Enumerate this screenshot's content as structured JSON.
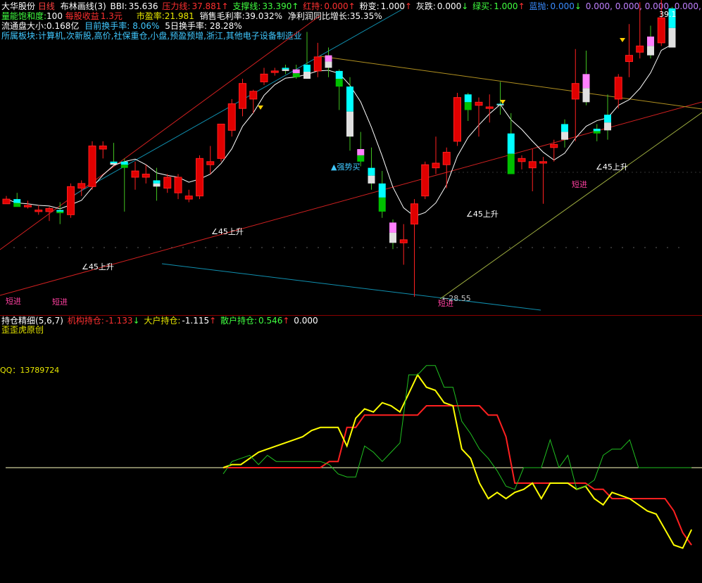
{
  "header": {
    "stock_name": "大华股份",
    "period": "日线",
    "indicator_name": "布林画线(3)",
    "bbi_label": "BBI:",
    "bbi_value": "35.636",
    "resistance_label": "压力线:",
    "resistance_value": "37.881",
    "support_label": "支撑线:",
    "support_value": "33.390",
    "red_hold_label": "红持:",
    "red_hold_value": "0.000",
    "pink_label": "粉变:",
    "pink_value": "1.000",
    "gray_label": "灰跌:",
    "gray_value": "0.000",
    "green_buy_label": "绿买:",
    "green_buy_value": "1.000",
    "blue_sell_label": "蓝抛:",
    "blue_sell_value": "0.000",
    "extra_values": "0.000, 0.000, 0.000, 0.000,",
    "arrow_up": "↑",
    "arrow_down": "↓"
  },
  "info": {
    "saturation_label": "量能饱和度:",
    "saturation_value": "100",
    "eps_label": "每股收益",
    "eps_value": "1.3元",
    "pe_label": "市盈率:",
    "pe_value": "21.981",
    "gross_margin_label": "销售毛利率:",
    "gross_margin_value": "39.032%",
    "profit_growth_label": "净利润同比增长:",
    "profit_growth_value": "35.35%",
    "float_label": "流通盘大小:",
    "float_value": "0.168亿",
    "turnover_label": "目前换手率:",
    "turnover_value": "8.06%",
    "turnover5_label": "5日换手率:",
    "turnover5_value": "28.28%",
    "sector_label": "所属板块:",
    "sector_value": "计算机,次新股,高价,社保重仓,小盘,预盈预增,浙江,其他电子设备制造业"
  },
  "annotations": {
    "price_high": "39.1",
    "price_low": "28.55",
    "short_entry": "短进",
    "rise45": "45上升",
    "strong_buy": "▲强势买"
  },
  "lower": {
    "title": "持仓精细",
    "params": "(5,6,7)",
    "inst_label": "机构持仓:",
    "inst_value": "-1.133",
    "big_label": "大户持仓:",
    "big_value": "-1.115",
    "retail_label": "散户持仓:",
    "retail_value": "0.546",
    "zero_value": "0.000",
    "watermark": "歪歪虎原创",
    "qq": "QQ：13789724"
  },
  "colors": {
    "up": "#ff0000",
    "down": "#00ffff",
    "pink": "#ff80ff",
    "green": "#00c000",
    "blue": "#0080ff",
    "yellow": "#ffff00",
    "white": "#ffffff",
    "cyan_line": "#00a0c0"
  },
  "chart_data": [
    {
      "type": "candlestick",
      "title": "大华股份 日线",
      "candles": [
        [
          34.5,
          35.0,
          34.6,
          34.8
        ],
        [
          34.8,
          35.2,
          34.5,
          34.3
        ],
        [
          34.3,
          34.7,
          34.2,
          34.4
        ],
        [
          34.0,
          34.4,
          33.8,
          34.1
        ],
        [
          34.0,
          34.3,
          33.4,
          34.2
        ],
        [
          34.1,
          34.6,
          33.2,
          33.9
        ],
        [
          33.8,
          35.8,
          33.6,
          35.6
        ],
        [
          35.5,
          36.0,
          35.0,
          35.8
        ],
        [
          35.6,
          38.5,
          35.4,
          38.2
        ],
        [
          38.0,
          38.5,
          37.4,
          38.2
        ],
        [
          37.2,
          38.4,
          37.0,
          37.0
        ],
        [
          37.2,
          37.4,
          34.0,
          36.8
        ],
        [
          36.2,
          37.2,
          35.4,
          36.6
        ],
        [
          36.2,
          37.0,
          35.8,
          36.4
        ],
        [
          36.0,
          36.8,
          34.7,
          35.6
        ],
        [
          35.5,
          36.4,
          35.2,
          36.2
        ],
        [
          35.2,
          36.4,
          34.8,
          36.2
        ],
        [
          34.8,
          35.4,
          34.6,
          35.0
        ],
        [
          35.0,
          37.6,
          34.8,
          37.4
        ],
        [
          37.0,
          38.2,
          36.4,
          37.2
        ],
        [
          37.4,
          39.6,
          37.2,
          39.6
        ],
        [
          39.2,
          41.2,
          38.8,
          40.9
        ],
        [
          40.6,
          42.5,
          40.1,
          42.2
        ],
        [
          41.2,
          41.8,
          40.3,
          41.7
        ],
        [
          42.3,
          43.2,
          42.1,
          42.8
        ],
        [
          42.9,
          43.2,
          42.7,
          43.0
        ],
        [
          43.2,
          43.4,
          42.8,
          43.0
        ],
        [
          43.1,
          43.4,
          42.5,
          42.6
        ],
        [
          43.4,
          45.5,
          42.5,
          42.5
        ],
        [
          43.0,
          44.8,
          42.6,
          43.9
        ],
        [
          44.0,
          44.5,
          42.6,
          43.2
        ],
        [
          43.0,
          43.1,
          40.5,
          42.0
        ],
        [
          42.0,
          42.6,
          37.9,
          38.8
        ],
        [
          38.0,
          39.1,
          36.9,
          37.2
        ],
        [
          36.8,
          38.1,
          35.4,
          35.8
        ],
        [
          35.8,
          36.6,
          33.6,
          34.0
        ],
        [
          33.3,
          33.5,
          31.6,
          32.0
        ],
        [
          32.0,
          33.2,
          30.6,
          32.2
        ],
        [
          33.2,
          34.8,
          28.55,
          34.5
        ],
        [
          35.0,
          37.2,
          34.8,
          37.0
        ],
        [
          36.8,
          38.8,
          36.4,
          37.1
        ],
        [
          37.0,
          38.1,
          35.5,
          37.8
        ],
        [
          38.5,
          41.6,
          38.2,
          41.3
        ],
        [
          41.5,
          41.6,
          39.8,
          40.5
        ],
        [
          40.8,
          41.3,
          38.8,
          41.0
        ],
        [
          40.6,
          41.5,
          39.7,
          40.7
        ],
        [
          40.9,
          42.3,
          40.2,
          40.8
        ],
        [
          39.0,
          40.3,
          37.0,
          36.4
        ],
        [
          37.2,
          37.6,
          36.7,
          37.4
        ],
        [
          36.8,
          38.0,
          35.3,
          37.2
        ],
        [
          37.1,
          37.5,
          34.5,
          37.2
        ],
        [
          38.1,
          38.6,
          37.2,
          38.3
        ],
        [
          39.6,
          39.9,
          38.1,
          38.6
        ],
        [
          41.2,
          44.4,
          38.5,
          42.2
        ],
        [
          42.8,
          44.3,
          40.8,
          41.0
        ],
        [
          39.3,
          39.6,
          38.5,
          39.0
        ],
        [
          40.2,
          41.5,
          38.6,
          39.2
        ],
        [
          41.2,
          42.8,
          40.6,
          42.6
        ],
        [
          43.6,
          46.0,
          42.6,
          44.0
        ],
        [
          44.2,
          47.4,
          43.8,
          44.6
        ],
        [
          45.2,
          45.9,
          43.8,
          44.0
        ],
        [
          44.8,
          47.7,
          44.6,
          46.4
        ],
        [
          47.0,
          47.1,
          45.6,
          44.5
        ]
      ],
      "annotations": [
        "39.1",
        "28.55",
        "短进",
        "45上升",
        "▲强势买"
      ]
    },
    {
      "type": "line",
      "title": "持仓精细(5,6,7)",
      "series": [
        {
          "name": "机构持仓",
          "color": "#ff2020",
          "values": [
            0,
            0,
            0,
            0,
            0,
            0,
            0,
            0,
            0,
            0,
            0,
            0,
            0.02,
            0.02,
            0.13,
            0.13,
            0.17,
            0.17,
            0.17,
            0.17,
            0.17,
            0.17,
            0.17,
            0.2,
            0.2,
            0.2,
            0.2,
            0.2,
            0.2,
            0.2,
            0.17,
            0.17,
            0.1,
            -0.05,
            -0.05,
            -0.05,
            -0.05,
            -0.05,
            -0.05,
            -0.05,
            -0.05,
            -0.05,
            -0.07,
            -0.07,
            -0.1,
            -0.1,
            -0.1,
            -0.1,
            -0.1,
            -0.1,
            -0.1,
            -0.14,
            -0.21,
            -0.25
          ]
        },
        {
          "name": "大户持仓",
          "color": "#ffff00",
          "values": [
            0,
            0.01,
            0.01,
            0.03,
            0.05,
            0.06,
            0.07,
            0.08,
            0.09,
            0.1,
            0.12,
            0.13,
            0.13,
            0.13,
            0.07,
            0.16,
            0.19,
            0.18,
            0.21,
            0.2,
            0.18,
            0.24,
            0.3,
            0.26,
            0.25,
            0.21,
            0.2,
            0.06,
            0.03,
            -0.05,
            -0.1,
            -0.08,
            -0.1,
            -0.08,
            -0.07,
            -0.05,
            -0.1,
            -0.05,
            -0.05,
            -0.05,
            -0.07,
            -0.06,
            -0.1,
            -0.12,
            -0.08,
            -0.09,
            -0.1,
            -0.12,
            -0.14,
            -0.15,
            -0.2,
            -0.25,
            -0.26,
            -0.2
          ]
        },
        {
          "name": "散户持仓",
          "color": "#20c020",
          "values": [
            -0.02,
            0.02,
            0.03,
            0.04,
            0.01,
            0.04,
            0.02,
            0.02,
            0.02,
            0.02,
            0.02,
            0.02,
            0.01,
            -0.02,
            -0.03,
            -0.03,
            0.07,
            0.05,
            0.02,
            0.05,
            0.08,
            0.3,
            0.3,
            0.33,
            0.33,
            0.26,
            0.26,
            0.15,
            0.11,
            0.06,
            0.03,
            -0.01,
            -0.06,
            -0.07,
            0.0,
            0.0,
            0.0,
            0.09,
            0.0,
            0.04,
            -0.07,
            -0.06,
            -0.04,
            0.04,
            0.06,
            0.06,
            0.09,
            0.0,
            0.0,
            0.0,
            0.0,
            0.0,
            0.0,
            0.0
          ]
        }
      ],
      "hline": 0.0
    }
  ]
}
